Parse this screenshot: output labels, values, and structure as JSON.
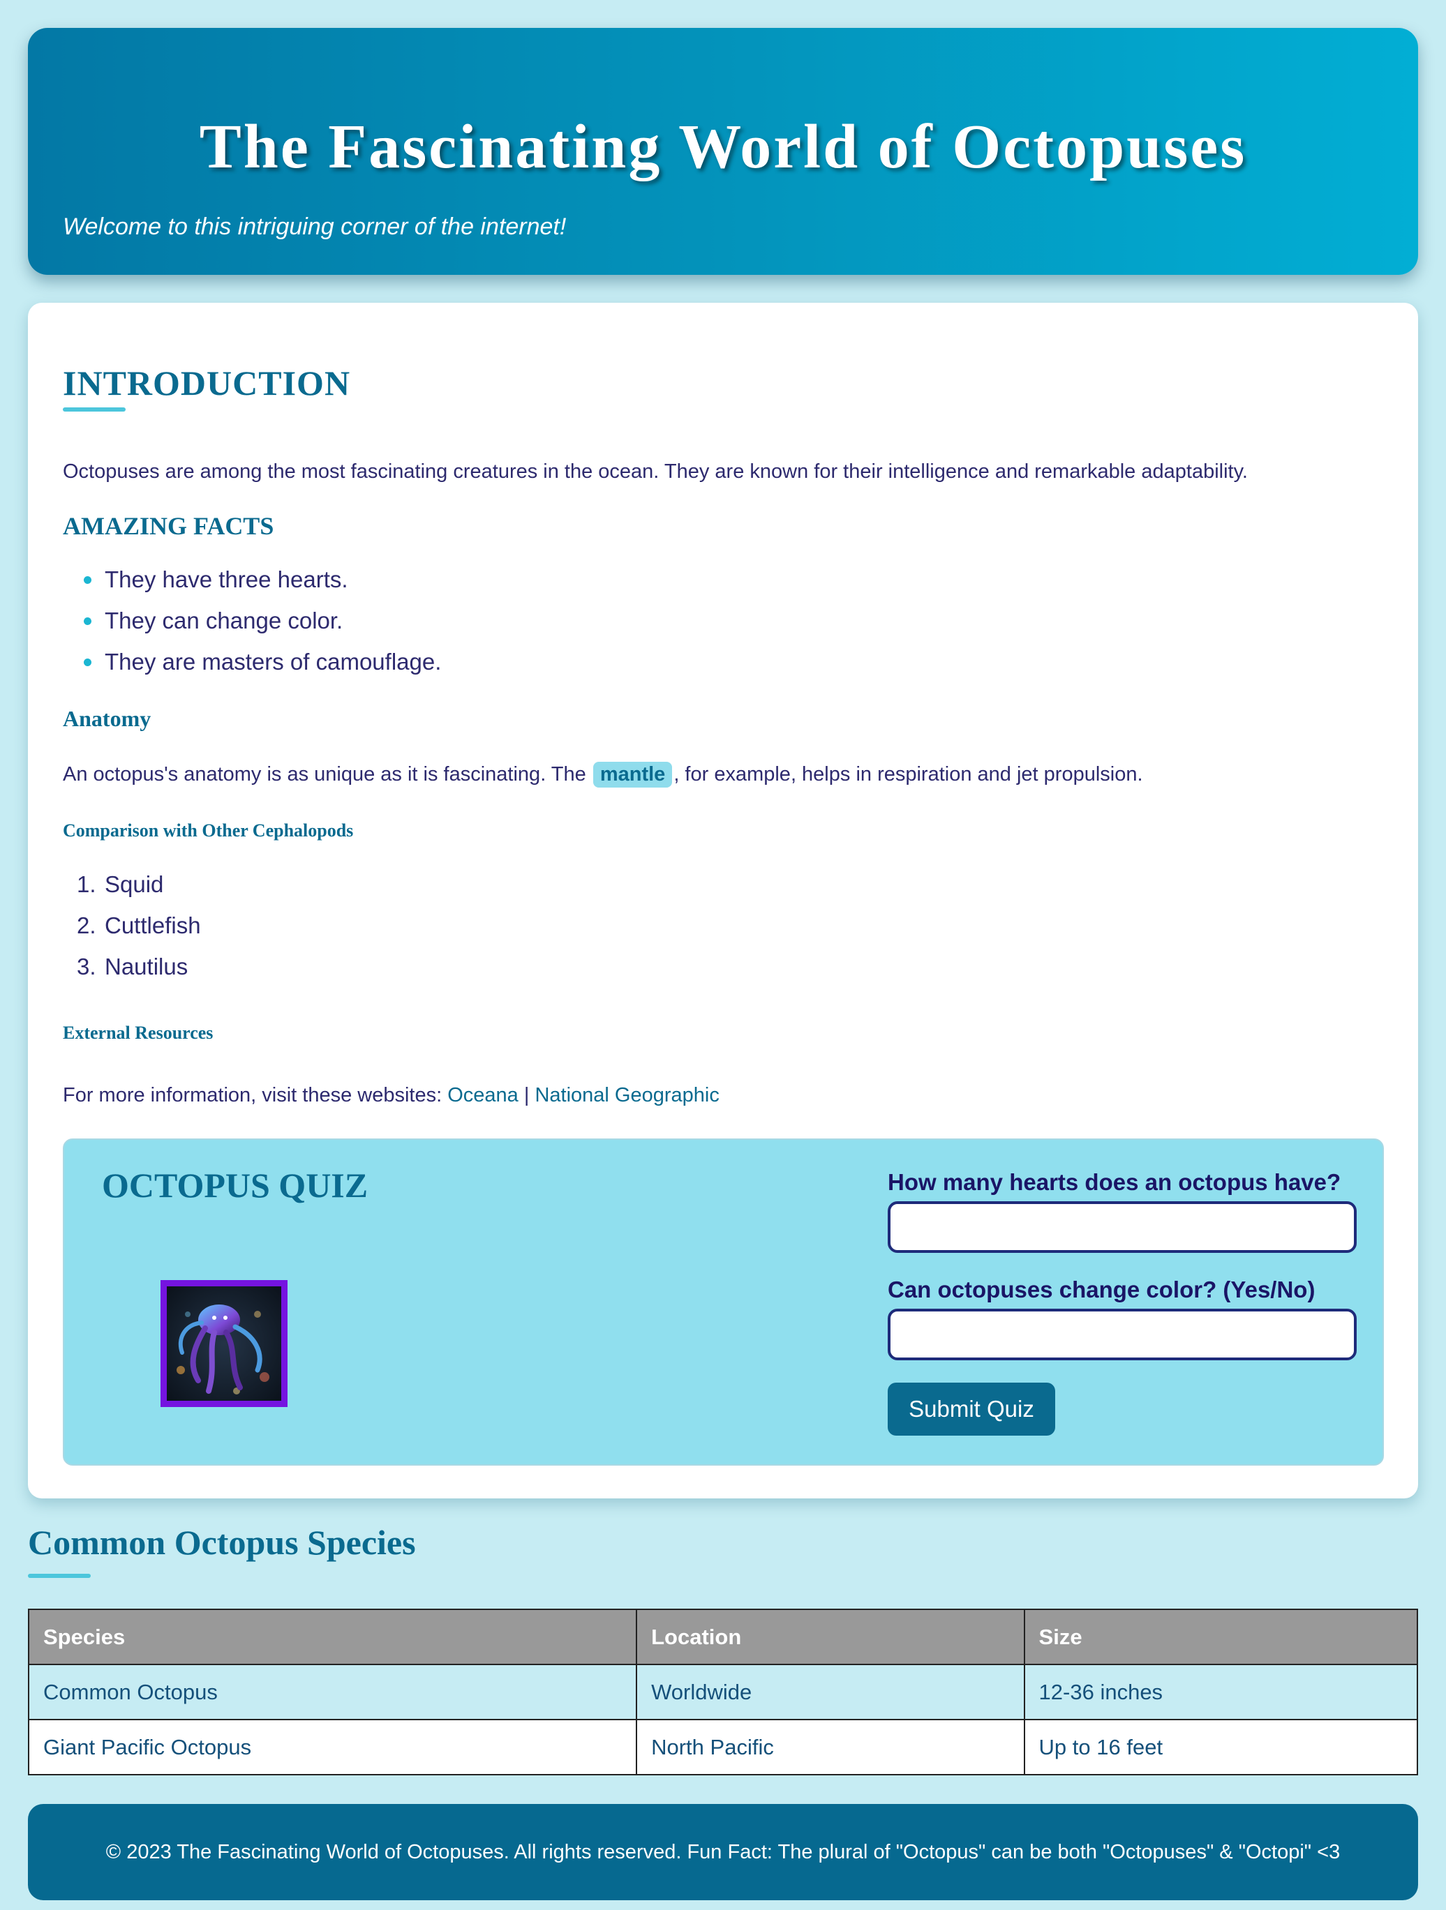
{
  "header": {
    "title": "The Fascinating World of Octopuses",
    "tagline": "Welcome to this intriguing corner of the internet!"
  },
  "intro": {
    "heading": "INTRODUCTION",
    "text": "Octopuses are among the most fascinating creatures in the ocean. They are known for their intelligence and remarkable adaptability."
  },
  "facts": {
    "heading": "AMAZING FACTS",
    "items": [
      "They have three hearts.",
      "They can change color.",
      "They are masters of camouflage."
    ]
  },
  "anatomy": {
    "heading": "Anatomy",
    "text_before": "An octopus's anatomy is as unique as it is fascinating. The",
    "highlight": "mantle",
    "text_after": ", for example, helps in respiration and jet propulsion."
  },
  "comparison": {
    "heading": "Comparison with Other Cephalopods",
    "items": [
      "Squid",
      "Cuttlefish",
      "Nautilus"
    ],
    "numbers": [
      "1.",
      "2.",
      "3."
    ]
  },
  "resources": {
    "heading": "External Resources",
    "text": "For more information, visit these websites:",
    "links": [
      "Oceana",
      "National Geographic"
    ],
    "separator": "|"
  },
  "quiz": {
    "title": "OCTOPUS QUIZ",
    "image_alt": "octopus-image",
    "questions": [
      {
        "label": "How many hearts does an octopus have?",
        "value": ""
      },
      {
        "label": "Can octopuses change color? (Yes/No)",
        "value": ""
      }
    ],
    "submit_label": "Submit Quiz"
  },
  "species": {
    "heading": "Common Octopus Species",
    "columns": [
      "Species",
      "Location",
      "Size"
    ],
    "rows": [
      [
        "Common Octopus",
        "Worldwide",
        "12-36 inches"
      ],
      [
        "Giant Pacific Octopus",
        "North Pacific",
        "Up to 16 feet"
      ]
    ]
  },
  "footer": {
    "text": "© 2023 The Fascinating World of Octopuses. All rights reserved. Fun Fact: The plural of \"Octopus\" can be both \"Octopuses\" & \"Octopi\" <3"
  },
  "colors": {
    "accent": "#0a6a8f",
    "header_gradient_start": "#0378a5",
    "header_gradient_end": "#02aed4",
    "page_background": "#c6ecf3",
    "quiz_background": "#90dfee",
    "image_border": "#7514e0"
  }
}
